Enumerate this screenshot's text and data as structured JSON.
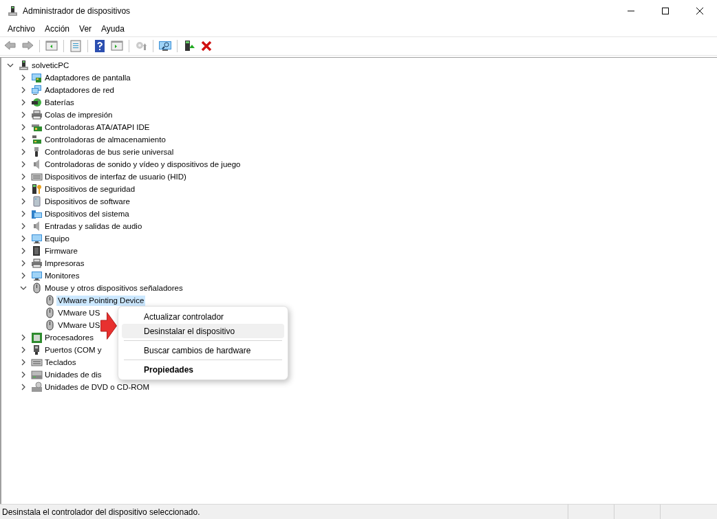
{
  "window": {
    "title": "Administrador de dispositivos"
  },
  "menu_bar": [
    "Archivo",
    "Acción",
    "Ver",
    "Ayuda"
  ],
  "toolbar": [
    {
      "kind": "back",
      "disabled": true
    },
    {
      "kind": "forward",
      "disabled": true
    },
    {
      "kind": "separator"
    },
    {
      "kind": "console-tree",
      "disabled": false
    },
    {
      "kind": "separator"
    },
    {
      "kind": "properties",
      "disabled": false
    },
    {
      "kind": "separator"
    },
    {
      "kind": "help",
      "disabled": false
    },
    {
      "kind": "action-pane",
      "disabled": false
    },
    {
      "kind": "separator"
    },
    {
      "kind": "update-driver",
      "disabled": true
    },
    {
      "kind": "separator"
    },
    {
      "kind": "scan",
      "disabled": false
    },
    {
      "kind": "separator"
    },
    {
      "kind": "enable",
      "disabled": false
    },
    {
      "kind": "uninstall",
      "disabled": false
    }
  ],
  "tree": {
    "label": "solveticPC",
    "expanded": true,
    "selected": false,
    "children": [
      {
        "label": "Adaptadores de pantalla",
        "expanded": false,
        "selected": false
      },
      {
        "label": "Adaptadores de red",
        "expanded": false,
        "selected": false
      },
      {
        "label": "Baterías",
        "expanded": false,
        "selected": false
      },
      {
        "label": "Colas de impresión",
        "expanded": false,
        "selected": false
      },
      {
        "label": "Controladoras ATA/ATAPI IDE",
        "expanded": false,
        "selected": false
      },
      {
        "label": "Controladoras de almacenamiento",
        "expanded": false,
        "selected": false
      },
      {
        "label": "Controladoras de bus serie universal",
        "expanded": false,
        "selected": false
      },
      {
        "label": "Controladoras de sonido y vídeo y dispositivos de juego",
        "expanded": false,
        "selected": false
      },
      {
        "label": "Dispositivos de interfaz de usuario (HID)",
        "expanded": false,
        "selected": false
      },
      {
        "label": "Dispositivos de seguridad",
        "expanded": false,
        "selected": false
      },
      {
        "label": "Dispositivos de software",
        "expanded": false,
        "selected": false
      },
      {
        "label": "Dispositivos del sistema",
        "expanded": false,
        "selected": false
      },
      {
        "label": "Entradas y salidas de audio",
        "expanded": false,
        "selected": false
      },
      {
        "label": "Equipo",
        "expanded": false,
        "selected": false
      },
      {
        "label": "Firmware",
        "expanded": false,
        "selected": false
      },
      {
        "label": "Impresoras",
        "expanded": false,
        "selected": false
      },
      {
        "label": "Monitores",
        "expanded": false,
        "selected": false
      },
      {
        "label": "Mouse y otros dispositivos señaladores",
        "expanded": true,
        "selected": false,
        "children": [
          {
            "label": "VMware Pointing Device",
            "selected": true
          },
          {
            "label": "VMware US",
            "selected": false
          },
          {
            "label": "VMware US",
            "selected": false
          }
        ]
      },
      {
        "label": "Procesadores",
        "expanded": false,
        "selected": false
      },
      {
        "label": "Puertos (COM y",
        "expanded": false,
        "selected": false
      },
      {
        "label": "Teclados",
        "expanded": false,
        "selected": false
      },
      {
        "label": "Unidades de dis",
        "expanded": false,
        "selected": false
      },
      {
        "label": "Unidades de DVD o CD-ROM",
        "expanded": false,
        "selected": false
      }
    ]
  },
  "context_menu": [
    {
      "kind": "item",
      "label": "Actualizar controlador",
      "highlighted": false
    },
    {
      "kind": "item",
      "label": "Desinstalar el dispositivo",
      "highlighted": true
    },
    {
      "kind": "separator"
    },
    {
      "kind": "item",
      "label": "Buscar cambios de hardware",
      "highlighted": false
    },
    {
      "kind": "separator"
    },
    {
      "kind": "default",
      "label": "Propiedades",
      "highlighted": false
    }
  ],
  "status_bar": "Desinstala el controlador del dispositivo seleccionado."
}
